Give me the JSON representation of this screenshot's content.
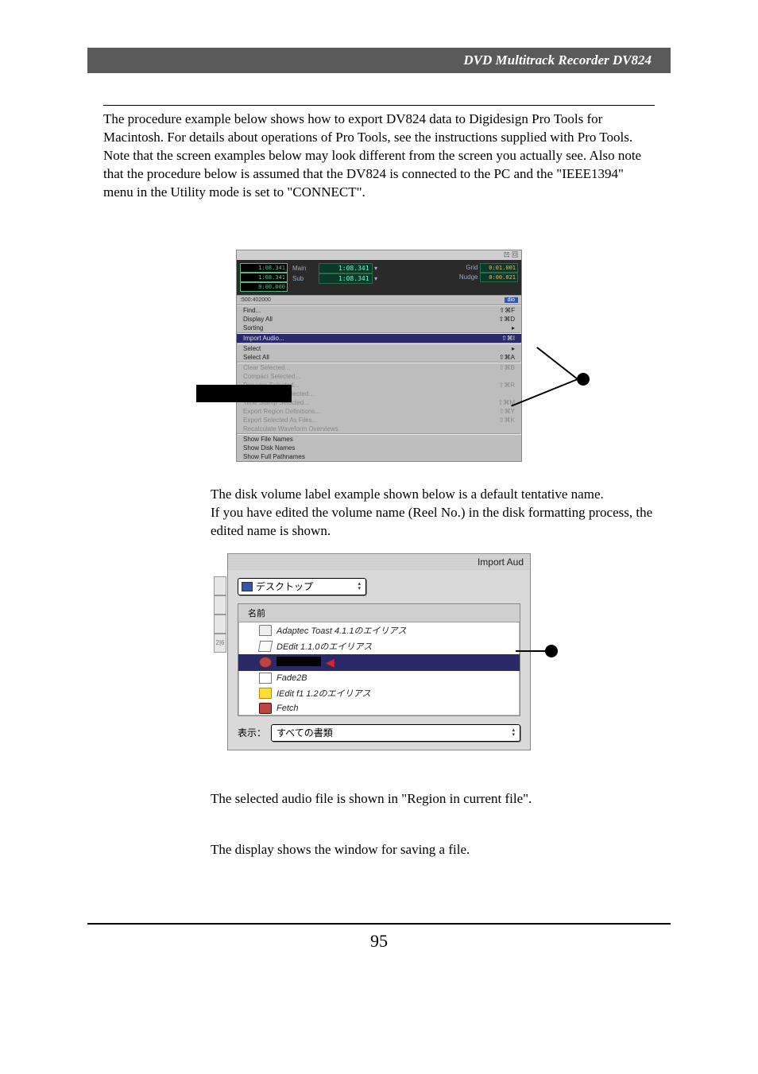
{
  "header": {
    "title": "DVD Multitrack Recorder DV824"
  },
  "intro": "The procedure example below shows how to export DV824 data to Digidesign Pro Tools for Macintosh. For details about operations of Pro Tools, see the instructions supplied with Pro Tools.  Note that the screen examples below may look different from the screen you actually see.  Also note that the procedure below is assumed that the DV824 is connected to the PC and the \"IEEE1394\" menu in the Utility mode is set to \"CONNECT\".",
  "pt": {
    "readouts": [
      "1:08.341",
      "1:08.341",
      "0:00.000"
    ],
    "main_label": "Main",
    "sub_label": "Sub",
    "main_value": "1:08.341",
    "sub_value": "1:08.341",
    "grid_label": "Grid",
    "nudge_label": "Nudge",
    "grid_value": "0:01.001",
    "nudge_value": "0:00.021",
    "ruler": {
      "left": ":50",
      "mid": "0:40",
      "right": "2000"
    },
    "menu_groups": [
      [
        {
          "label": "Find...",
          "short": "⇧⌘F",
          "enabled": true
        },
        {
          "label": "Display All",
          "short": "⇧⌘D",
          "enabled": true
        },
        {
          "label": "Sorting",
          "short": "▸",
          "enabled": true
        }
      ],
      [
        {
          "label": "Import Audio...",
          "short": "⇧⌘I",
          "enabled": true,
          "highlight": true
        }
      ],
      [
        {
          "label": "Select",
          "short": "▸",
          "enabled": true
        },
        {
          "label": "Select All",
          "short": "⇧⌘A",
          "enabled": true
        }
      ],
      [
        {
          "label": "Clear Selected...",
          "short": "⇧⌘B",
          "enabled": false
        },
        {
          "label": "Compact Selected...",
          "short": "",
          "enabled": false
        },
        {
          "label": "Rename Selected...",
          "short": "⇧⌘R",
          "enabled": false
        },
        {
          "label": "Auto Rename Selected...",
          "short": "",
          "enabled": false
        },
        {
          "label": "Time Stamp Selected...",
          "short": "⇧⌘M",
          "enabled": false
        },
        {
          "label": "Export Region Definitions...",
          "short": "⇧⌘Y",
          "enabled": false
        },
        {
          "label": "Export Selected As Files...",
          "short": "⇧⌘K",
          "enabled": false
        },
        {
          "label": "Recalculate Waveform Overviews",
          "short": "",
          "enabled": false
        }
      ],
      [
        {
          "label": "Show File Names",
          "short": "",
          "enabled": true
        },
        {
          "label": "Show Disk Names",
          "short": "",
          "enabled": true
        },
        {
          "label": "Show Full Pathnames",
          "short": "",
          "enabled": true
        }
      ]
    ],
    "track_label": "dio"
  },
  "caption1": "The disk volume label example shown below is a default tentative name.\nIf you have edited the volume name (Reel No.) in the disk formatting process, the edited name is shown.",
  "dialog": {
    "title": "Import Aud",
    "location": "デスクトップ",
    "header": "名前",
    "items": [
      {
        "icon": "folder",
        "label": "Adaptec Toast 4.1.1のエイリアス"
      },
      {
        "icon": "app",
        "label": "DEdit 1.1.0のエイリアス"
      },
      {
        "icon": "disk",
        "label": "",
        "selected": true,
        "redacted": true
      },
      {
        "icon": "doc",
        "label": "Fade2B"
      },
      {
        "icon": "bedit",
        "label": "IEdit f1 1.2のエイリアス"
      },
      {
        "icon": "dog",
        "label": "Fetch"
      }
    ],
    "show_label": "表示：",
    "show_value": "すべての書類",
    "side_tabs": [
      "",
      "",
      "",
      "2|6"
    ]
  },
  "caption2": "The selected audio file is shown in \"Region in current file\".",
  "caption3": "The display shows the window for saving a file.",
  "pageNumber": "95"
}
